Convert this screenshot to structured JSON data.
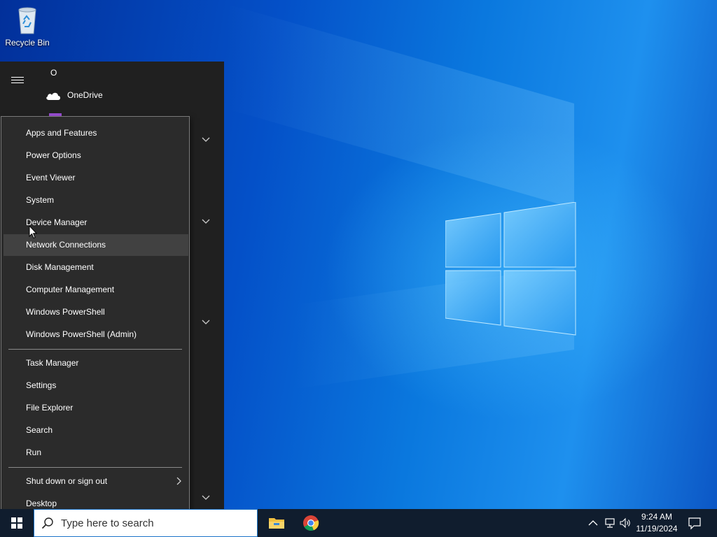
{
  "desktop": {
    "icons": [
      {
        "label": "Recycle Bin",
        "icon": "recycle-bin-icon"
      }
    ]
  },
  "start_menu": {
    "section_letter": "O",
    "apps": [
      {
        "label": "OneDrive",
        "icon": "onedrive-cloud-icon"
      }
    ]
  },
  "context_menu": {
    "group1": [
      "Apps and Features",
      "Power Options",
      "Event Viewer",
      "System",
      "Device Manager",
      "Network Connections",
      "Disk Management",
      "Computer Management",
      "Windows PowerShell",
      "Windows PowerShell (Admin)"
    ],
    "group2": [
      "Task Manager",
      "Settings",
      "File Explorer",
      "Search",
      "Run"
    ],
    "group3": [
      "Shut down or sign out",
      "Desktop"
    ],
    "hovered_item": "Network Connections"
  },
  "taskbar": {
    "search_placeholder": "Type here to search",
    "pinned_apps": [
      "file-explorer-icon",
      "chrome-icon"
    ],
    "tray_icons": [
      "chevron-up-icon",
      "network-icon",
      "volume-icon"
    ],
    "time": "9:24 AM",
    "date": "11/19/2024"
  },
  "colors": {
    "taskbar_bg": "#101d2e",
    "menu_bg": "#2b2b2b",
    "menu_hover": "#414141",
    "start_menu_bg": "#202020",
    "accent": "#0078d7"
  }
}
